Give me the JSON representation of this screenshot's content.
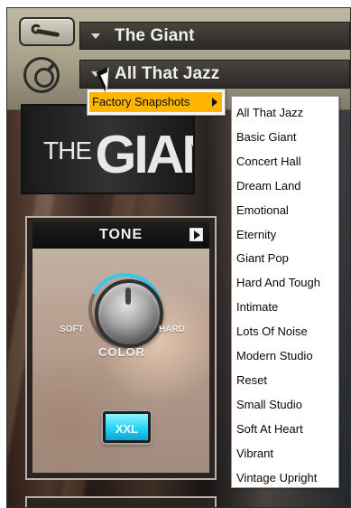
{
  "header": {
    "instrument_name": "The Giant",
    "snapshot_name": "All That Jazz"
  },
  "hero": {
    "brand_prefix": "THE",
    "brand_name": "GIANT"
  },
  "tone_panel": {
    "title": "TONE",
    "soft_label": "SOFT",
    "hard_label": "HARD",
    "color_label": "COLOR",
    "color_level": 0.62,
    "xxl_label": "XXL",
    "accent_color": "#33c8f0"
  },
  "menus": {
    "factory": {
      "label": "Factory Snapshots",
      "highlight_color": "#ffb400"
    },
    "snapshots": [
      "All That Jazz",
      "Basic Giant",
      "Concert Hall",
      "Dream Land",
      "Emotional",
      "Eternity",
      "Giant Pop",
      "Hard And Tough",
      "Intimate",
      "Lots Of Noise",
      "Modern Studio",
      "Reset",
      "Small Studio",
      "Soft At Heart",
      "Vibrant",
      "Vintage Upright"
    ]
  },
  "icons": {
    "settings": "wrench-icon",
    "logo": "badge-icon",
    "play": "play-icon",
    "submenu": "submenu-arrow-icon",
    "cursor": "mouse-cursor-icon"
  }
}
